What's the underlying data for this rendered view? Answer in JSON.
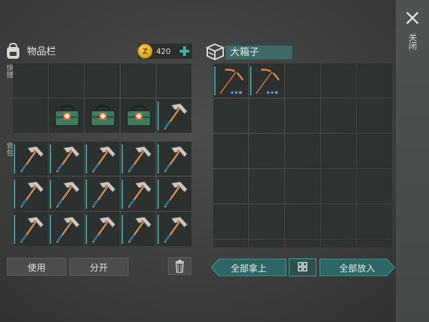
{
  "inventory": {
    "title": "物品栏",
    "coins": "420",
    "coin_symbol": "Z",
    "hotbar_label": "快捷",
    "backpack_label": "背包",
    "use_label": "使用",
    "split_label": "分开"
  },
  "chest": {
    "title": "大箱子",
    "take_all_label": "全部拿上",
    "put_all_label": "全部放入"
  },
  "close": {
    "label": "关闭"
  },
  "colors": {
    "accent": "#3fa39c",
    "gold": "#f2c43a"
  },
  "items": {
    "quick_slots": [
      "",
      "",
      "",
      "",
      "",
      "",
      "medkit-icon",
      "medkit-icon",
      "medkit-icon",
      "hatchet-icon"
    ],
    "backpack_slots": [
      "hatchet-icon",
      "hatchet-icon",
      "hatchet-icon",
      "hatchet-icon",
      "hatchet-icon",
      "hatchet-icon",
      "hatchet-icon",
      "hatchet-icon",
      "hatchet-icon",
      "hatchet-icon",
      "hatchet-icon",
      "hatchet-icon",
      "hatchet-icon",
      "hatchet-icon",
      "hatchet-icon"
    ],
    "chest_slots_filled": [
      "pickaxe-icon",
      "pickaxe-icon"
    ]
  }
}
